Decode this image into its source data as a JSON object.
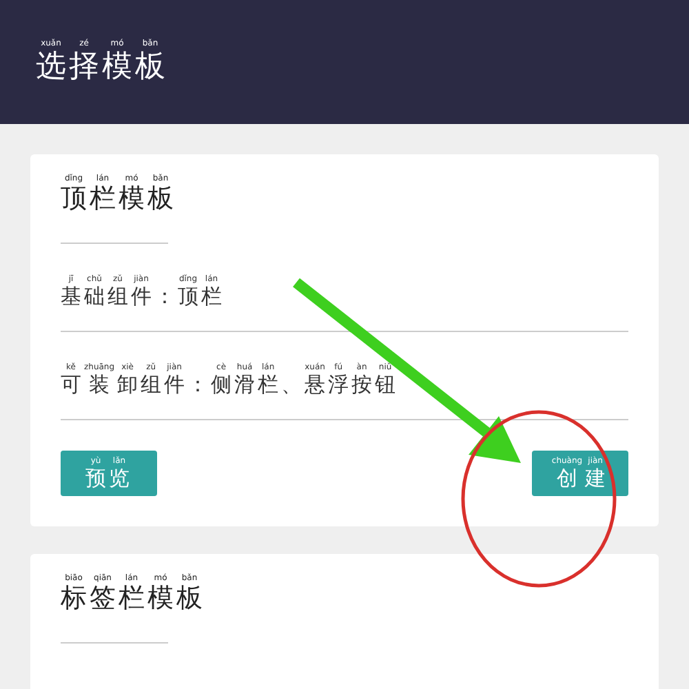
{
  "header": {
    "title": [
      [
        "xuǎn",
        "选"
      ],
      [
        "zé",
        "择"
      ],
      [
        "mó",
        "模"
      ],
      [
        "bǎn",
        "板"
      ]
    ]
  },
  "cards": [
    {
      "title": [
        [
          "dǐng",
          "顶"
        ],
        [
          "lán",
          "栏"
        ],
        [
          "mó",
          "模"
        ],
        [
          "bǎn",
          "板"
        ]
      ],
      "rows": [
        [
          [
            "jī",
            "基"
          ],
          [
            "chǔ",
            "础"
          ],
          [
            "zǔ",
            "组"
          ],
          [
            "jiàn",
            "件"
          ],
          [
            "",
            "："
          ],
          [
            "dǐng",
            "顶"
          ],
          [
            "lán",
            "栏"
          ]
        ],
        [
          [
            "kě",
            "可"
          ],
          [
            "zhuāng",
            "装"
          ],
          [
            "xiè",
            "卸"
          ],
          [
            "zǔ",
            "组"
          ],
          [
            "jiàn",
            "件"
          ],
          [
            "",
            "："
          ],
          [
            "cè",
            "侧"
          ],
          [
            "huá",
            "滑"
          ],
          [
            "lán",
            "栏"
          ],
          [
            "",
            "、"
          ],
          [
            "xuán",
            "悬"
          ],
          [
            "fú",
            "浮"
          ],
          [
            "àn",
            "按"
          ],
          [
            "niǔ",
            "钮"
          ]
        ]
      ],
      "buttons": [
        [
          [
            "yù",
            "预"
          ],
          [
            "lǎn",
            "览"
          ]
        ],
        [
          [
            "chuàng",
            "创"
          ],
          [
            "jiàn",
            "建"
          ]
        ]
      ]
    },
    {
      "title": [
        [
          "biāo",
          "标"
        ],
        [
          "qiān",
          "签"
        ],
        [
          "lán",
          "栏"
        ],
        [
          "mó",
          "模"
        ],
        [
          "bǎn",
          "板"
        ]
      ]
    }
  ]
}
